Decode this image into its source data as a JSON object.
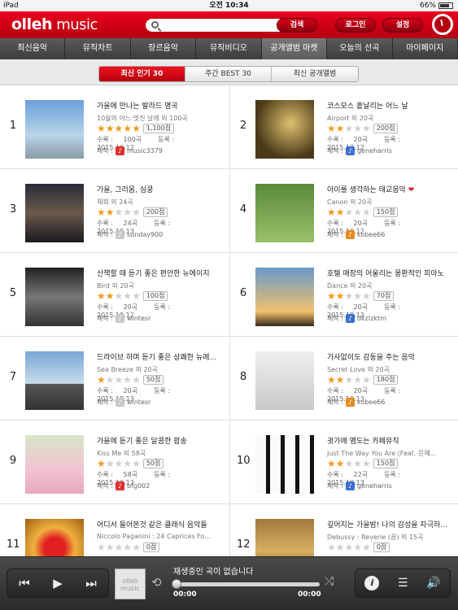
{
  "status": {
    "device": "iPad",
    "time": "오전 10:34",
    "battery": "66%"
  },
  "header": {
    "logo_bold": "olleh",
    "logo_regular": " music",
    "search_placeholder": "",
    "search_label": "검색",
    "login_label": "로그인",
    "settings_label": "설정"
  },
  "nav": [
    "최신음악",
    "뮤직차트",
    "장르음악",
    "뮤직비디오",
    "공개앨범 마켓",
    "오늘의 선곡",
    "마이페이지"
  ],
  "subtabs": [
    "최신 인기 30",
    "주간 BEST 30",
    "최신 공개앨범"
  ],
  "labels": {
    "tracks": "수록 : ",
    "registered": "등록 : ",
    "maker": "제작 : "
  },
  "items": [
    {
      "rank": "1",
      "title": "가을에 만나는 발라드 명곡",
      "artist": "10월의 어느 멋진 날에 외 100곡",
      "stars": 5,
      "points": "1,100점",
      "tracks": "100곡",
      "date": "2015.10.12",
      "maker": "music3379",
      "maker_color": "#e0302f"
    },
    {
      "rank": "2",
      "title": "코스모스 흩날리는 어느 날",
      "artist": "Airport 외 20곡",
      "stars": 2,
      "points": "200점",
      "tracks": "20곡",
      "date": "2015.10.12",
      "maker": "geneharris",
      "maker_color": "#3b6fd1"
    },
    {
      "rank": "3",
      "title": "가을, 그리움, 심쿵",
      "artist": "재회 외 24곡",
      "stars": 2,
      "points": "200점",
      "tracks": "24곡",
      "date": "2015.10.13",
      "maker": "sunday900",
      "maker_color": "#c8c8c8"
    },
    {
      "rank": "4",
      "title": "아이를 생각하는 태교음악",
      "artist": "Canon 외 20곡",
      "stars": 2,
      "points": "150점",
      "tracks": "20곡",
      "date": "2015.10.12",
      "maker": "kobee66",
      "maker_color": "#e58a1e",
      "heart": "❤"
    },
    {
      "rank": "5",
      "title": "산책할 때 듣기 좋은 편안한 뉴에이지",
      "artist": "Bird 외 20곡",
      "stars": 1.5,
      "points": "100점",
      "tracks": "20곡",
      "date": "2015.10.12",
      "maker": "wintesr",
      "maker_color": "#c8c8c8"
    },
    {
      "rank": "6",
      "title": "호텔 매장의 어울리는 몽환적인 피아노",
      "artist": "Dance 외 20곡",
      "stars": 1.5,
      "points": "70점",
      "tracks": "20곡",
      "date": "2015.10.13",
      "maker": "dkzlzktm",
      "maker_color": "#3b6fd1"
    },
    {
      "rank": "7",
      "title": "드라이브 하며 듣기 좋은 상쾌한 뉴에...",
      "artist": "Sea Breeze 외 20곡",
      "stars": 1,
      "points": "50점",
      "tracks": "20곡",
      "date": "2015.10.13",
      "maker": "wintesr",
      "maker_color": "#c8c8c8"
    },
    {
      "rank": "8",
      "title": "가사없이도 감동을 주는 음악",
      "artist": "Secret Love 외 20곡",
      "stars": 2,
      "points": "180점",
      "tracks": "20곡",
      "date": "2015.10.13",
      "maker": "kobee66",
      "maker_color": "#e58a1e"
    },
    {
      "rank": "9",
      "title": "가을에 듣기 좋은 달콤한 팝송",
      "artist": "Kiss Me 외 58곡",
      "stars": 1,
      "points": "50점",
      "tracks": "58곡",
      "date": "2015.10.13",
      "maker": "bfg002",
      "maker_color": "#e0302f"
    },
    {
      "rank": "10",
      "title": "귓가에 맴도는 카페뮤직",
      "artist": "Just The Way You Are (Feat. 문혜...",
      "stars": 2,
      "points": "150점",
      "tracks": "22곡",
      "date": "2015.10.13",
      "maker": "geneharris",
      "maker_color": "#3b6fd1"
    },
    {
      "rank": "11",
      "title": "어디서 들어본것 같은 클래식 음악들",
      "artist": "Niccolo Paganini : 24 Caprices Fo...",
      "stars": 0,
      "points": "0점",
      "tracks": "",
      "date": "",
      "maker": "",
      "maker_color": "#c8c8c8"
    },
    {
      "rank": "12",
      "title": "깊어지는 가을밤! 나의 감성을 자극하...",
      "artist": "Debussy : Reverie (꿈) 외 15곡",
      "stars": 0,
      "points": "0점",
      "tracks": "",
      "date": "",
      "maker": "",
      "maker_color": "#c8c8c8"
    }
  ],
  "player": {
    "now_playing": "재생중인 곡이 없습니다",
    "time_left": "00:00",
    "time_right": "00:00",
    "art_text": "olleh music",
    "progress": 0
  },
  "colors": {
    "brand_red": "#e8001c",
    "star": "#f19a1e"
  }
}
